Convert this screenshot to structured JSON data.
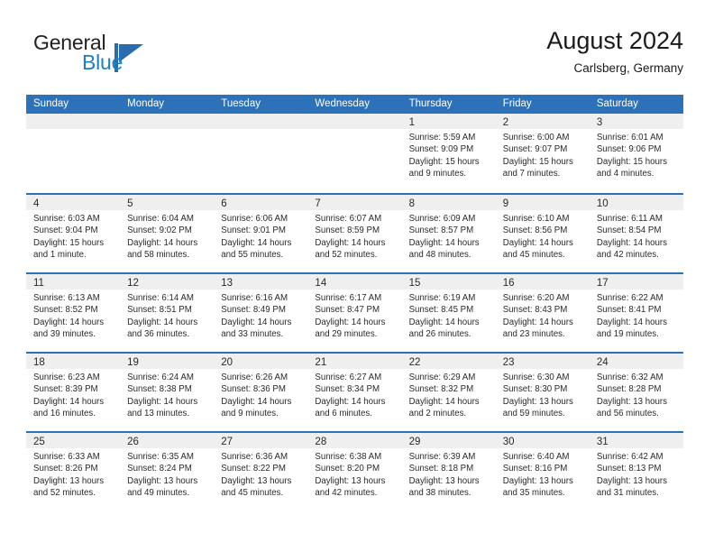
{
  "brand": {
    "word_general": "General",
    "word_blue": "Blue",
    "mark": "triangle-flag-logo"
  },
  "header": {
    "title": "August 2024",
    "subtitle": "Carlsberg, Germany"
  },
  "calendar": {
    "weekday_headers": [
      "Sunday",
      "Monday",
      "Tuesday",
      "Wednesday",
      "Thursday",
      "Friday",
      "Saturday"
    ],
    "accent_color": "#2d72b8",
    "daynum_band_color": "#efefef",
    "weeks": [
      [
        {
          "day": "",
          "sunrise": "",
          "sunset": "",
          "daylight_1": "",
          "daylight_2": "",
          "empty": true
        },
        {
          "day": "",
          "sunrise": "",
          "sunset": "",
          "daylight_1": "",
          "daylight_2": "",
          "empty": true
        },
        {
          "day": "",
          "sunrise": "",
          "sunset": "",
          "daylight_1": "",
          "daylight_2": "",
          "empty": true
        },
        {
          "day": "",
          "sunrise": "",
          "sunset": "",
          "daylight_1": "",
          "daylight_2": "",
          "empty": true
        },
        {
          "day": "1",
          "sunrise": "Sunrise: 5:59 AM",
          "sunset": "Sunset: 9:09 PM",
          "daylight_1": "Daylight: 15 hours",
          "daylight_2": "and 9 minutes."
        },
        {
          "day": "2",
          "sunrise": "Sunrise: 6:00 AM",
          "sunset": "Sunset: 9:07 PM",
          "daylight_1": "Daylight: 15 hours",
          "daylight_2": "and 7 minutes."
        },
        {
          "day": "3",
          "sunrise": "Sunrise: 6:01 AM",
          "sunset": "Sunset: 9:06 PM",
          "daylight_1": "Daylight: 15 hours",
          "daylight_2": "and 4 minutes."
        }
      ],
      [
        {
          "day": "4",
          "sunrise": "Sunrise: 6:03 AM",
          "sunset": "Sunset: 9:04 PM",
          "daylight_1": "Daylight: 15 hours",
          "daylight_2": "and 1 minute."
        },
        {
          "day": "5",
          "sunrise": "Sunrise: 6:04 AM",
          "sunset": "Sunset: 9:02 PM",
          "daylight_1": "Daylight: 14 hours",
          "daylight_2": "and 58 minutes."
        },
        {
          "day": "6",
          "sunrise": "Sunrise: 6:06 AM",
          "sunset": "Sunset: 9:01 PM",
          "daylight_1": "Daylight: 14 hours",
          "daylight_2": "and 55 minutes."
        },
        {
          "day": "7",
          "sunrise": "Sunrise: 6:07 AM",
          "sunset": "Sunset: 8:59 PM",
          "daylight_1": "Daylight: 14 hours",
          "daylight_2": "and 52 minutes."
        },
        {
          "day": "8",
          "sunrise": "Sunrise: 6:09 AM",
          "sunset": "Sunset: 8:57 PM",
          "daylight_1": "Daylight: 14 hours",
          "daylight_2": "and 48 minutes."
        },
        {
          "day": "9",
          "sunrise": "Sunrise: 6:10 AM",
          "sunset": "Sunset: 8:56 PM",
          "daylight_1": "Daylight: 14 hours",
          "daylight_2": "and 45 minutes."
        },
        {
          "day": "10",
          "sunrise": "Sunrise: 6:11 AM",
          "sunset": "Sunset: 8:54 PM",
          "daylight_1": "Daylight: 14 hours",
          "daylight_2": "and 42 minutes."
        }
      ],
      [
        {
          "day": "11",
          "sunrise": "Sunrise: 6:13 AM",
          "sunset": "Sunset: 8:52 PM",
          "daylight_1": "Daylight: 14 hours",
          "daylight_2": "and 39 minutes."
        },
        {
          "day": "12",
          "sunrise": "Sunrise: 6:14 AM",
          "sunset": "Sunset: 8:51 PM",
          "daylight_1": "Daylight: 14 hours",
          "daylight_2": "and 36 minutes."
        },
        {
          "day": "13",
          "sunrise": "Sunrise: 6:16 AM",
          "sunset": "Sunset: 8:49 PM",
          "daylight_1": "Daylight: 14 hours",
          "daylight_2": "and 33 minutes."
        },
        {
          "day": "14",
          "sunrise": "Sunrise: 6:17 AM",
          "sunset": "Sunset: 8:47 PM",
          "daylight_1": "Daylight: 14 hours",
          "daylight_2": "and 29 minutes."
        },
        {
          "day": "15",
          "sunrise": "Sunrise: 6:19 AM",
          "sunset": "Sunset: 8:45 PM",
          "daylight_1": "Daylight: 14 hours",
          "daylight_2": "and 26 minutes."
        },
        {
          "day": "16",
          "sunrise": "Sunrise: 6:20 AM",
          "sunset": "Sunset: 8:43 PM",
          "daylight_1": "Daylight: 14 hours",
          "daylight_2": "and 23 minutes."
        },
        {
          "day": "17",
          "sunrise": "Sunrise: 6:22 AM",
          "sunset": "Sunset: 8:41 PM",
          "daylight_1": "Daylight: 14 hours",
          "daylight_2": "and 19 minutes."
        }
      ],
      [
        {
          "day": "18",
          "sunrise": "Sunrise: 6:23 AM",
          "sunset": "Sunset: 8:39 PM",
          "daylight_1": "Daylight: 14 hours",
          "daylight_2": "and 16 minutes."
        },
        {
          "day": "19",
          "sunrise": "Sunrise: 6:24 AM",
          "sunset": "Sunset: 8:38 PM",
          "daylight_1": "Daylight: 14 hours",
          "daylight_2": "and 13 minutes."
        },
        {
          "day": "20",
          "sunrise": "Sunrise: 6:26 AM",
          "sunset": "Sunset: 8:36 PM",
          "daylight_1": "Daylight: 14 hours",
          "daylight_2": "and 9 minutes."
        },
        {
          "day": "21",
          "sunrise": "Sunrise: 6:27 AM",
          "sunset": "Sunset: 8:34 PM",
          "daylight_1": "Daylight: 14 hours",
          "daylight_2": "and 6 minutes."
        },
        {
          "day": "22",
          "sunrise": "Sunrise: 6:29 AM",
          "sunset": "Sunset: 8:32 PM",
          "daylight_1": "Daylight: 14 hours",
          "daylight_2": "and 2 minutes."
        },
        {
          "day": "23",
          "sunrise": "Sunrise: 6:30 AM",
          "sunset": "Sunset: 8:30 PM",
          "daylight_1": "Daylight: 13 hours",
          "daylight_2": "and 59 minutes."
        },
        {
          "day": "24",
          "sunrise": "Sunrise: 6:32 AM",
          "sunset": "Sunset: 8:28 PM",
          "daylight_1": "Daylight: 13 hours",
          "daylight_2": "and 56 minutes."
        }
      ],
      [
        {
          "day": "25",
          "sunrise": "Sunrise: 6:33 AM",
          "sunset": "Sunset: 8:26 PM",
          "daylight_1": "Daylight: 13 hours",
          "daylight_2": "and 52 minutes."
        },
        {
          "day": "26",
          "sunrise": "Sunrise: 6:35 AM",
          "sunset": "Sunset: 8:24 PM",
          "daylight_1": "Daylight: 13 hours",
          "daylight_2": "and 49 minutes."
        },
        {
          "day": "27",
          "sunrise": "Sunrise: 6:36 AM",
          "sunset": "Sunset: 8:22 PM",
          "daylight_1": "Daylight: 13 hours",
          "daylight_2": "and 45 minutes."
        },
        {
          "day": "28",
          "sunrise": "Sunrise: 6:38 AM",
          "sunset": "Sunset: 8:20 PM",
          "daylight_1": "Daylight: 13 hours",
          "daylight_2": "and 42 minutes."
        },
        {
          "day": "29",
          "sunrise": "Sunrise: 6:39 AM",
          "sunset": "Sunset: 8:18 PM",
          "daylight_1": "Daylight: 13 hours",
          "daylight_2": "and 38 minutes."
        },
        {
          "day": "30",
          "sunrise": "Sunrise: 6:40 AM",
          "sunset": "Sunset: 8:16 PM",
          "daylight_1": "Daylight: 13 hours",
          "daylight_2": "and 35 minutes."
        },
        {
          "day": "31",
          "sunrise": "Sunrise: 6:42 AM",
          "sunset": "Sunset: 8:13 PM",
          "daylight_1": "Daylight: 13 hours",
          "daylight_2": "and 31 minutes."
        }
      ]
    ]
  }
}
